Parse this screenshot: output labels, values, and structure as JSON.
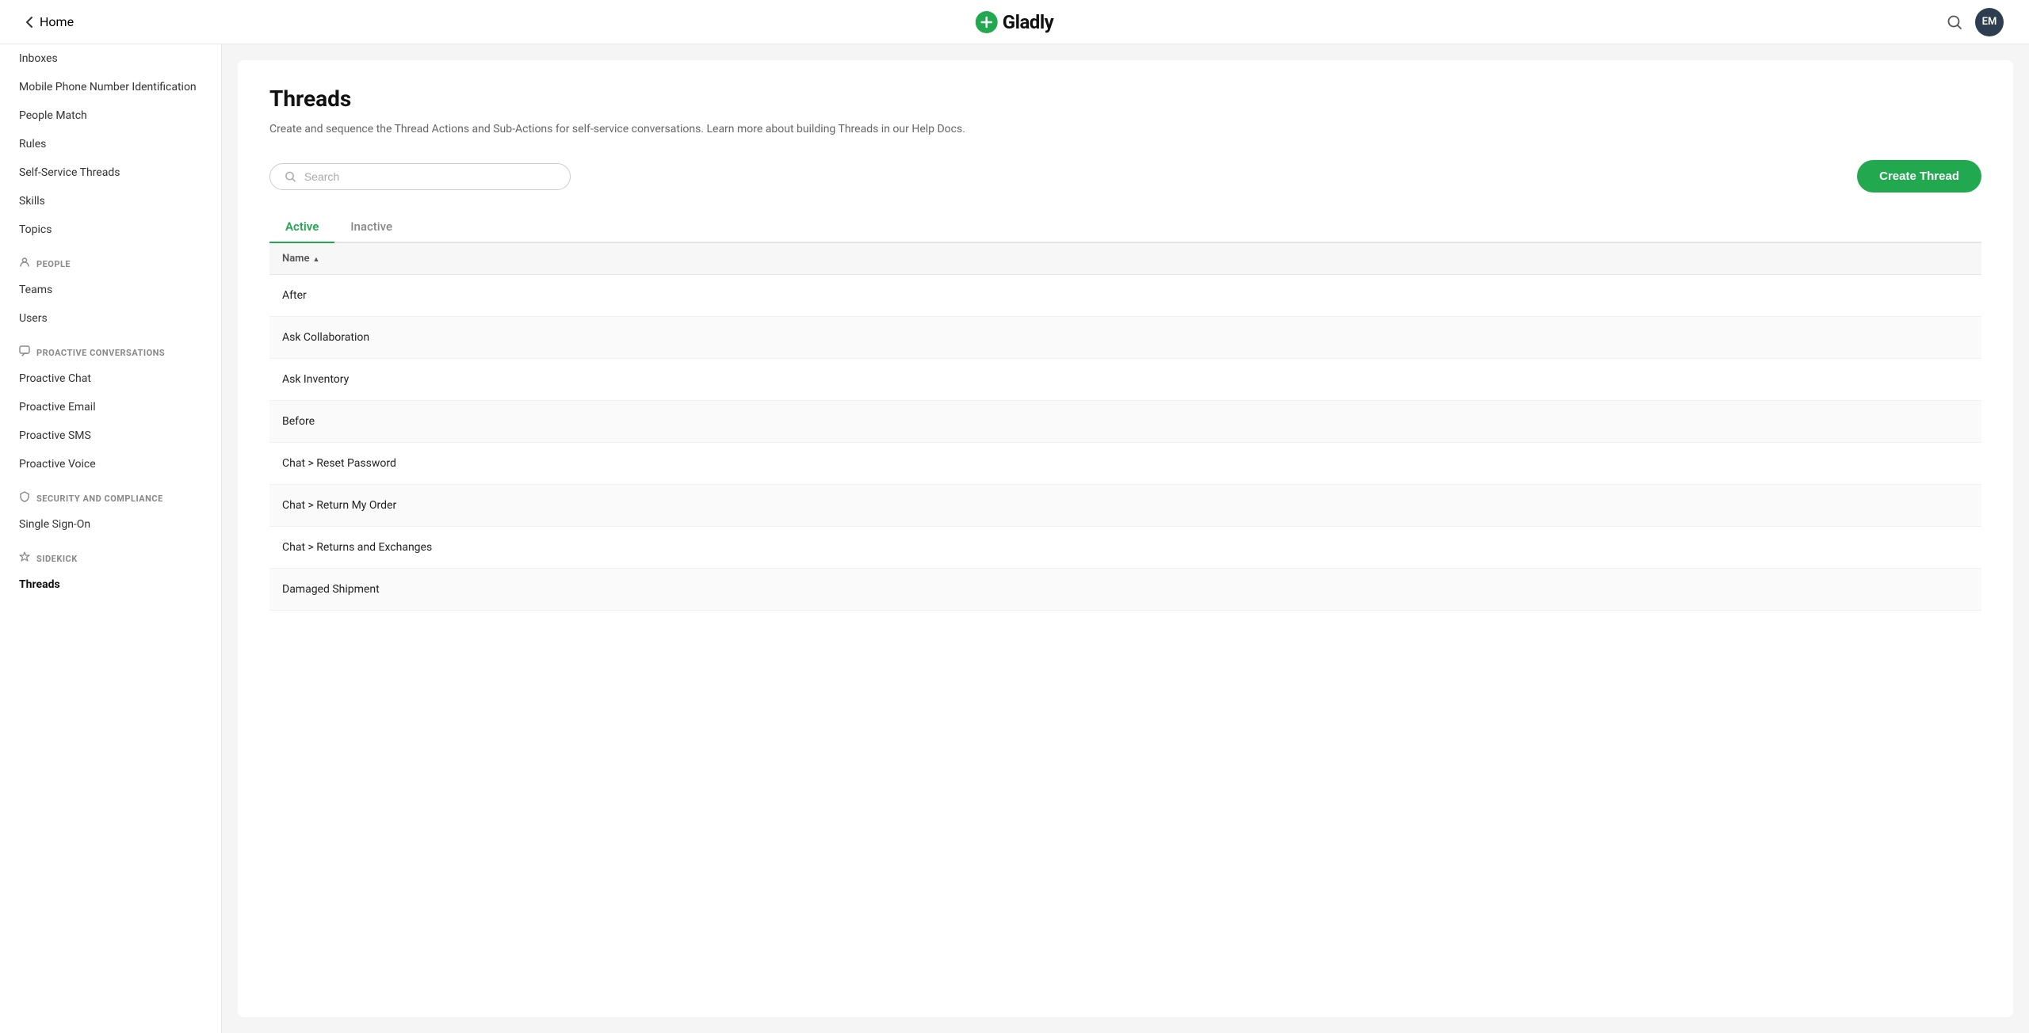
{
  "topNav": {
    "backLabel": "Home",
    "logoText": "Gladly",
    "avatarText": "EM"
  },
  "sidebar": {
    "topItems": [
      {
        "label": "Inboxes"
      },
      {
        "label": "Mobile Phone Number Identification"
      },
      {
        "label": "People Match"
      },
      {
        "label": "Rules"
      },
      {
        "label": "Self-Service Threads"
      },
      {
        "label": "Skills"
      },
      {
        "label": "Topics"
      }
    ],
    "sections": [
      {
        "label": "PEOPLE",
        "icon": "person",
        "items": [
          {
            "label": "Teams"
          },
          {
            "label": "Users"
          }
        ]
      },
      {
        "label": "PROACTIVE CONVERSATIONS",
        "icon": "chat",
        "items": [
          {
            "label": "Proactive Chat"
          },
          {
            "label": "Proactive Email"
          },
          {
            "label": "Proactive SMS"
          },
          {
            "label": "Proactive Voice"
          }
        ]
      },
      {
        "label": "SECURITY AND COMPLIANCE",
        "icon": "shield",
        "items": [
          {
            "label": "Single Sign-On"
          }
        ]
      },
      {
        "label": "SIDEKICK",
        "icon": "star",
        "items": [
          {
            "label": "Threads",
            "active": true
          }
        ]
      }
    ]
  },
  "main": {
    "title": "Threads",
    "description": "Create and sequence the Thread Actions and Sub-Actions for self-service conversations. Learn more about building Threads in our Help Docs.",
    "searchPlaceholder": "Search",
    "createButtonLabel": "Create Thread",
    "tabs": [
      {
        "label": "Active",
        "active": true
      },
      {
        "label": "Inactive",
        "active": false
      }
    ],
    "tableHeader": {
      "nameLabel": "Name"
    },
    "rows": [
      {
        "name": "After"
      },
      {
        "name": "Ask Collaboration"
      },
      {
        "name": "Ask Inventory"
      },
      {
        "name": "Before"
      },
      {
        "name": "Chat > Reset Password"
      },
      {
        "name": "Chat > Return My Order"
      },
      {
        "name": "Chat > Returns and Exchanges"
      },
      {
        "name": "Damaged Shipment"
      }
    ]
  }
}
